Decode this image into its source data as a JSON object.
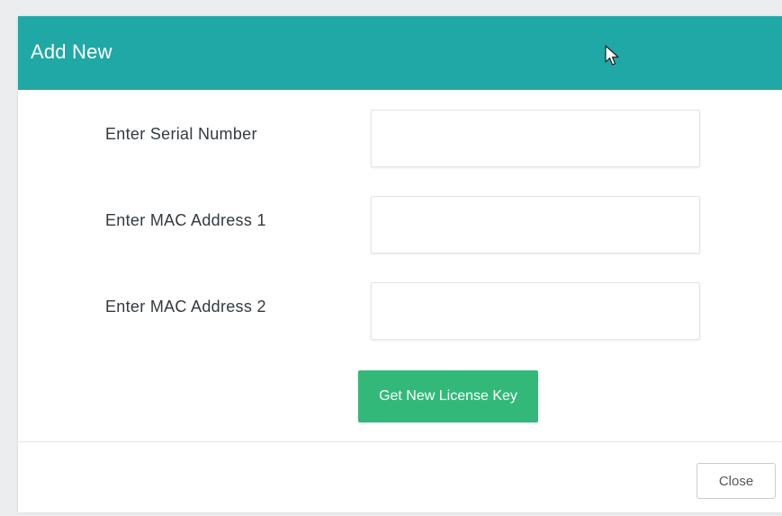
{
  "modal": {
    "title": "Add New",
    "header_color": "#20a8a6"
  },
  "form": {
    "serial_number": {
      "label": "Enter Serial Number",
      "value": "",
      "placeholder": ""
    },
    "mac_address_1": {
      "label": "Enter MAC Address 1",
      "value": "",
      "placeholder": ""
    },
    "mac_address_2": {
      "label": "Enter MAC Address 2",
      "value": "",
      "placeholder": ""
    },
    "submit_label": "Get New License Key",
    "submit_color": "#32b97a"
  },
  "footer": {
    "close_label": "Close"
  },
  "icons": {
    "cursor": "mouse-pointer-icon"
  }
}
